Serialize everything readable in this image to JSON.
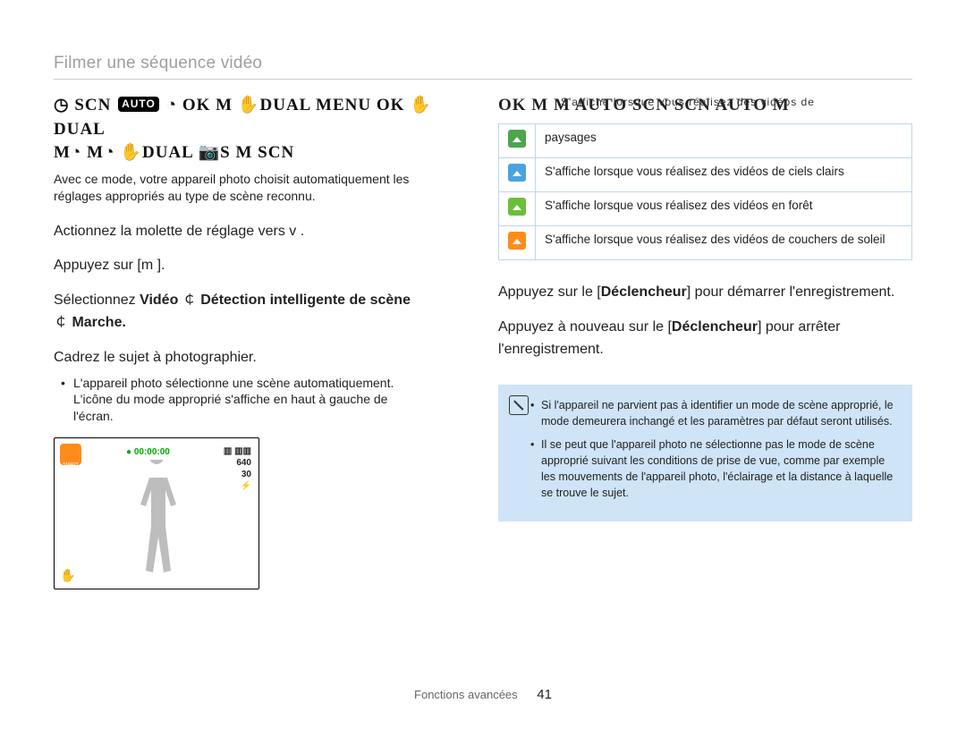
{
  "breadcrumb": "Filmer une séquence vidéo",
  "left": {
    "iconbar_main": "◷   SCN ",
    "iconbar_auto": "AUTO",
    "iconbar_rest": " ◔  OK M  ✋DUAL  MENU OK ✋DUAL",
    "iconbar_line2": "M◔     M◔   ✋DUAL   📷S  M  SCN",
    "intro_line1": "Avec ce mode, votre appareil photo choisit automatiquement les",
    "intro_line2": "réglages appropriés au type de scène reconnu.",
    "step1": "Actionnez la molette de réglage vers v  .",
    "step2": "Appuyez sur [m     ].",
    "step3_a": "Sélectionnez ",
    "step3_b": "Vidéo",
    "step3_c": " ￠ ",
    "step3_d": "Détection intelligente de scène",
    "step3_e": " ￠ ",
    "step3_f": "Marche.",
    "step4": "Cadrez le sujet à photographier.",
    "bullet_l1": "L'appareil photo sélectionne une scène automatiquement.",
    "bullet_l2": "L'icône du mode approprié s'affiche en haut à gauche de",
    "bullet_l3": "l'écran.",
    "lcd": {
      "rec": "●  00:00:00",
      "batt": "▥  ▥▥",
      "res": "640",
      "fps": "30",
      "flash": "⚡"
    }
  },
  "right": {
    "iconbar": "OK M M ",
    "iconbar_auto": "AUTO",
    "iconbar_mid": "  SCN SCN ",
    "iconbar_auto2": "AUTO",
    "iconbar_end": " M",
    "overlay": "S'affiche lorsque vous réalisez des vidéos de",
    "table": [
      {
        "color": "c-green",
        "text": "paysages"
      },
      {
        "color": "c-blue",
        "text": "S'affiche lorsque vous réalisez des vidéos de ciels clairs"
      },
      {
        "color": "c-green2",
        "text": "S'affiche lorsque vous réalisez des vidéos en forêt"
      },
      {
        "color": "c-orange",
        "text": "S'affiche lorsque vous réalisez des vidéos de couchers de soleil"
      }
    ],
    "step5_a": "Appuyez sur le [",
    "step5_b": "Déclencheur",
    "step5_c": "] pour démarrer l'enregistrement.",
    "step6_a": "Appuyez à nouveau sur le [",
    "step6_b": "Déclencheur",
    "step6_c": "] pour arrêter l'enregistrement.",
    "note1": "Si l'appareil ne parvient pas à identifier un mode de scène approprié, le mode      demeurera inchangé et les paramètres par défaut seront utilisés.",
    "note2": "Il se peut que l'appareil photo ne sélectionne pas le mode de scène approprié suivant les conditions de prise de vue, comme par exemple les mouvements de l'appareil photo, l'éclairage et la distance à laquelle se trouve le sujet."
  },
  "footer": {
    "section": "Fonctions avancées",
    "page": "41"
  }
}
